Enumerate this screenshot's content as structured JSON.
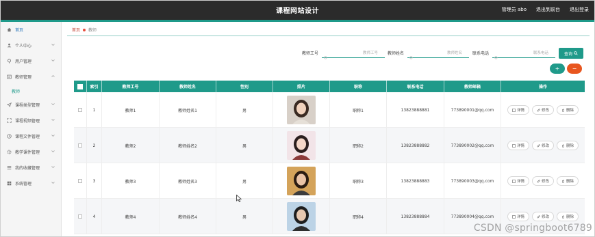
{
  "header": {
    "title": "课程网站设计",
    "links": [
      "管理员 abo",
      "退出到前台",
      "退出登录"
    ]
  },
  "sidebar": {
    "items": [
      {
        "label": "首页",
        "icon": "home-icon"
      },
      {
        "label": "个人中心",
        "icon": "user-icon"
      },
      {
        "label": "用户管理",
        "icon": "person-pin-icon"
      },
      {
        "label": "教师管理",
        "icon": "teacher-icon",
        "sub": [
          "教师"
        ]
      },
      {
        "label": "课程类型管理",
        "icon": "send-icon"
      },
      {
        "label": "课程视频管理",
        "icon": "expand-icon"
      },
      {
        "label": "课程文件管理",
        "icon": "clock-icon"
      },
      {
        "label": "教学课件管理",
        "icon": "gear-icon"
      },
      {
        "label": "我的收藏管理",
        "icon": "list-icon"
      },
      {
        "label": "系统管理",
        "icon": "grid-icon"
      }
    ]
  },
  "breadcrumb": {
    "home": "首页",
    "current": "教师"
  },
  "search": {
    "fields": [
      {
        "label": "教师工号",
        "placeholder": "教师工号"
      },
      {
        "label": "教师姓名",
        "placeholder": "教师姓名"
      },
      {
        "label": "联系电话",
        "placeholder": "联系电话"
      }
    ],
    "query_label": "查询"
  },
  "actions": {
    "add_label": "+",
    "delete_label": "−"
  },
  "table": {
    "columns": [
      "索引",
      "教师工号",
      "教师姓名",
      "性别",
      "照片",
      "职称",
      "联系电话",
      "教师邮箱",
      "操作"
    ],
    "ops": [
      "详情",
      "修改",
      "删除"
    ],
    "rows": [
      {
        "index": "1",
        "id": "教师1",
        "name": "教师姓名1",
        "gender": "男",
        "title": "职称1",
        "phone": "13823888881",
        "email": "773890001@qq.com"
      },
      {
        "index": "2",
        "id": "教师2",
        "name": "教师姓名2",
        "gender": "男",
        "title": "职称2",
        "phone": "13823888882",
        "email": "773890002@qq.com"
      },
      {
        "index": "3",
        "id": "教师3",
        "name": "教师姓名3",
        "gender": "男",
        "title": "职称3",
        "phone": "13823888883",
        "email": "773890003@qq.com"
      },
      {
        "index": "4",
        "id": "教师4",
        "name": "教师姓名4",
        "gender": "男",
        "title": "职称4",
        "phone": "13823888884",
        "email": "773890004@qq.com"
      }
    ]
  },
  "watermark": "CSDN @springboot6789",
  "colors": {
    "accent": "#1f9a8a",
    "danger": "#e8561f",
    "header_bg": "#2b2b2b"
  }
}
